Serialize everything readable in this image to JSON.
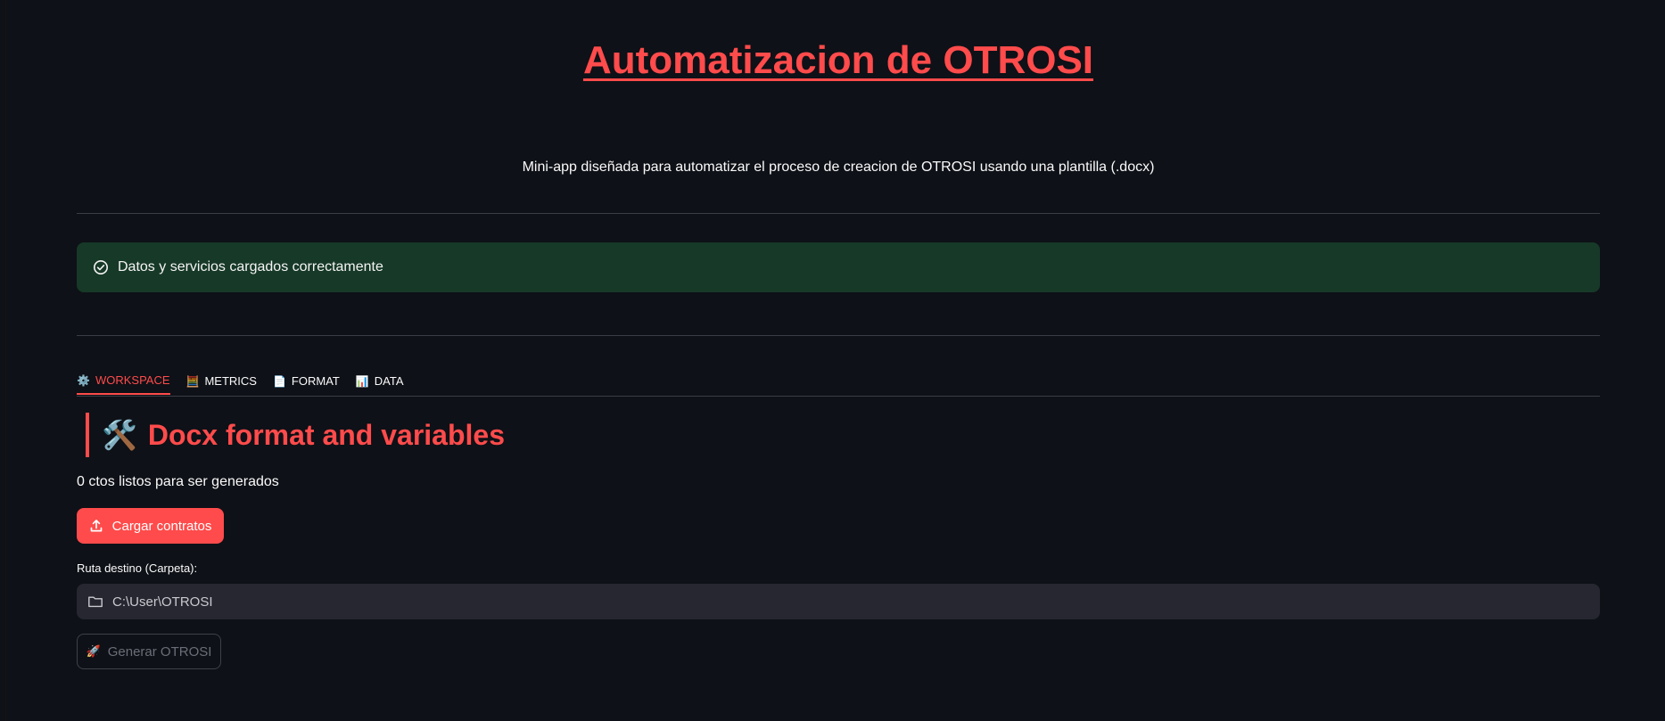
{
  "header": {
    "title": "Automatizacion de OTROSI",
    "subtitle": "Mini-app diseñada para automatizar el proceso de creacion de OTROSI usando una plantilla (.docx)"
  },
  "alert": {
    "message": "Datos y servicios cargados correctamente",
    "icon": "check-circle-icon",
    "color": "#173928"
  },
  "tabs": [
    {
      "label": "WORKSPACE",
      "icon": "⚙️",
      "active": true
    },
    {
      "label": "METRICS",
      "icon": "🧮",
      "active": false
    },
    {
      "label": "FORMAT",
      "icon": "📄",
      "active": false
    },
    {
      "label": "DATA",
      "icon": "📊",
      "active": false
    }
  ],
  "workspace": {
    "section_icon": "🛠️",
    "section_title": "Docx format and variables",
    "ready_text": "0 ctos listos para ser generados",
    "upload_button": "Cargar contratos",
    "path_label": "Ruta destino (Carpeta):",
    "path_value": "C:\\User\\OTROSI",
    "generate_icon": "🚀",
    "generate_button": "Generar OTROSI"
  },
  "colors": {
    "accent": "#ff4b4b",
    "background": "#0e1117",
    "input_bg": "#262730"
  }
}
